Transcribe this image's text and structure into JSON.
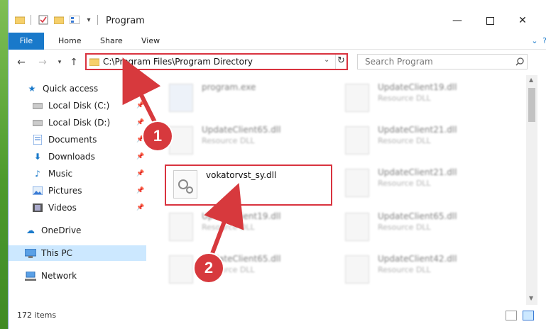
{
  "window": {
    "title": "Program"
  },
  "ribbon": {
    "tabs": [
      "File",
      "Home",
      "Share",
      "View"
    ]
  },
  "address": {
    "path": "C:\\Program Files\\Program Directory"
  },
  "search": {
    "placeholder": "Search Program"
  },
  "nav": {
    "quick_access": "Quick access",
    "items": [
      "Local Disk (C:)",
      "Local Disk (D:)",
      "Documents",
      "Downloads",
      "Music",
      "Pictures",
      "Videos"
    ],
    "onedrive": "OneDrive",
    "this_pc": "This PC",
    "network": "Network"
  },
  "files": [
    {
      "name": "program.exe",
      "type": ""
    },
    {
      "name": "UpdateClient19.dll",
      "type": "Resource DLL"
    },
    {
      "name": "UpdateClient65.dll",
      "type": "Resource DLL"
    },
    {
      "name": "UpdateClient21.dll",
      "type": "Resource DLL"
    },
    {
      "name": "vokatorvst_sy.dll",
      "type": ""
    },
    {
      "name": "UpdateClient21.dll",
      "type": "Resource DLL"
    },
    {
      "name": "UpdateClient19.dll",
      "type": "Resource DLL"
    },
    {
      "name": "UpdateClient65.dll",
      "type": "Resource DLL"
    },
    {
      "name": "UpdateClient65.dll",
      "type": "Resource DLL"
    },
    {
      "name": "UpdateClient42.dll",
      "type": "Resource DLL"
    }
  ],
  "status": {
    "count": "172 items"
  },
  "annotations": {
    "step1": "1",
    "step2": "2"
  },
  "colors": {
    "accent": "#1979ca",
    "highlight": "#d9333f",
    "selected": "#cce8ff"
  }
}
